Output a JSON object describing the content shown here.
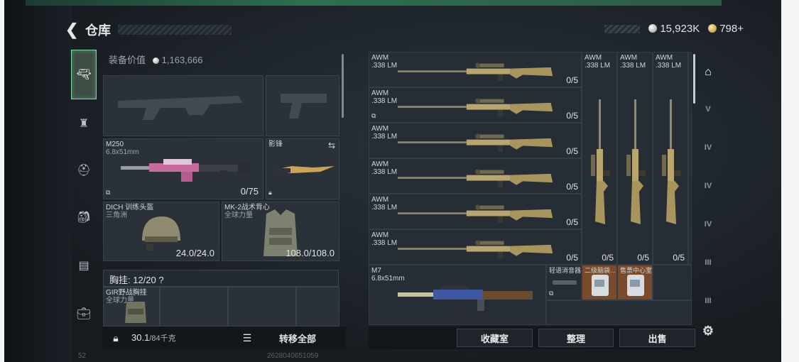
{
  "header": {
    "back_icon": "chevron-left-icon",
    "title": "仓库"
  },
  "currency": {
    "silver": "15,923K",
    "gold": "798+"
  },
  "left_nav": {
    "items": [
      {
        "name": "nav-weapons",
        "icon": "pistol-icon",
        "glyph": "🔫︎"
      },
      {
        "name": "nav-armor",
        "icon": "armor-icon",
        "glyph": "♜"
      },
      {
        "name": "nav-helmet",
        "icon": "helmet-icon",
        "glyph": "⛑︎"
      },
      {
        "name": "nav-backpack",
        "icon": "backpack-icon",
        "glyph": "🎒︎"
      },
      {
        "name": "nav-vest",
        "icon": "vest-icon",
        "glyph": "▤"
      },
      {
        "name": "nav-case",
        "icon": "briefcase-icon",
        "glyph": "💼︎"
      }
    ]
  },
  "equipment": {
    "value_label": "装备价值",
    "value": "1,163,666",
    "primary_weapon": {
      "name": "M250",
      "caliber": "6.8x51mm",
      "ammo": "0/75"
    },
    "melee": {
      "name": "影锋"
    },
    "helmet": {
      "name": "DICH 训练头盔",
      "brand": "三角洲",
      "durability": "24.0/24.0"
    },
    "armor": {
      "name": "MK-2战术背心",
      "brand": "全球力量",
      "durability": "108.0/108.0"
    },
    "chest_rig_label": "胸挂: 12/20 ?",
    "chest_rig": {
      "name": "GIR野战胸挂",
      "brand": "全球力量"
    }
  },
  "bottom_left": {
    "weight": "30.1",
    "weight_max": "/84千克",
    "transfer": "转移全部"
  },
  "stash": {
    "awm_rows": [
      {
        "name": "AWM",
        "caliber": ".338 LM",
        "ammo": "0/5"
      },
      {
        "name": "AWM",
        "caliber": ".338 LM",
        "ammo": "0/5"
      },
      {
        "name": "AWM",
        "caliber": ".338 LM",
        "ammo": "0/5"
      },
      {
        "name": "AWM",
        "caliber": ".338 LM",
        "ammo": "0/5"
      },
      {
        "name": "AWM",
        "caliber": ".338 LM",
        "ammo": "0/5"
      },
      {
        "name": "AWM",
        "caliber": ".338 LM",
        "ammo": "0/5"
      }
    ],
    "awm_vertical": [
      {
        "name": "AWM",
        "caliber": ".338 LM",
        "ammo": "0/5"
      },
      {
        "name": "AWM",
        "caliber": ".338 LM",
        "ammo": "0/5"
      },
      {
        "name": "AWM",
        "caliber": ".338 LM",
        "ammo": "0/5"
      }
    ],
    "m7": {
      "name": "M7",
      "caliber": "6.8x51mm"
    },
    "small_items": [
      {
        "name": "轻语消音器"
      },
      {
        "name": "二级脑袋..."
      },
      {
        "name": "售票中心室"
      }
    ]
  },
  "stash_buttons": {
    "collection": "收藏室",
    "organize": "整理",
    "sell": "出售"
  },
  "right_nav": {
    "items": [
      {
        "name": "tab-all",
        "icon": "stash-all-icon",
        "glyph": "⌂"
      },
      {
        "name": "tab-v",
        "icon": "tier-v-icon",
        "glyph": "V"
      },
      {
        "name": "tab-iv-a",
        "icon": "tier-iv-icon",
        "glyph": "IV"
      },
      {
        "name": "tab-iv-b",
        "icon": "tier-iv-icon",
        "glyph": "IV"
      },
      {
        "name": "tab-iv-c",
        "icon": "tier-iv-icon",
        "glyph": "IV"
      },
      {
        "name": "tab-iii-a",
        "icon": "tier-iii-icon",
        "glyph": "III"
      },
      {
        "name": "tab-iii-b",
        "icon": "tier-iii-icon",
        "glyph": "III"
      }
    ],
    "settings_icon": "gear-icon"
  },
  "footer": {
    "left": "52",
    "right": "2628040651059"
  }
}
